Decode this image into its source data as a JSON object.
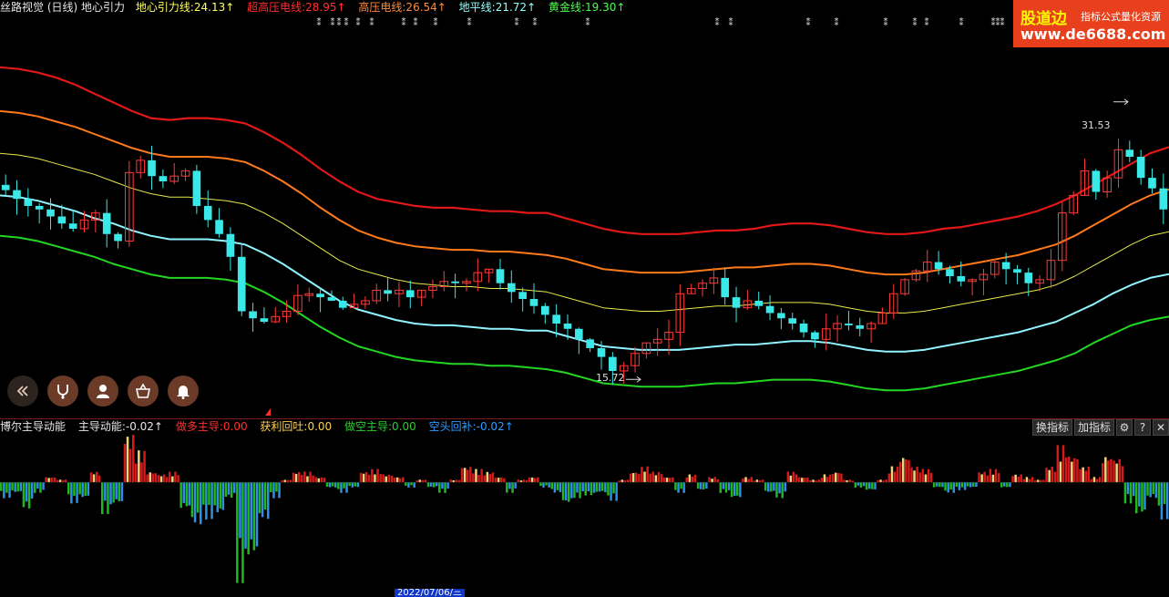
{
  "header": {
    "title": "丝路视觉 (日线) 地心引力",
    "indicators": [
      {
        "label": "地心引力线:24.13↑",
        "color": "#ffff66"
      },
      {
        "label": "超高压电线:28.95↑",
        "color": "#ff3030"
      },
      {
        "label": "高压电线:26.54↑",
        "color": "#ff8a3c"
      },
      {
        "label": "地平线:21.72↑",
        "color": "#8fffff"
      },
      {
        "label": "黄金线:19.30↑",
        "color": "#4dff4d"
      }
    ]
  },
  "logo": {
    "name": "股道边",
    "slogan": "指标公式量化资源",
    "url": "www.de6688.com"
  },
  "annotations": {
    "high": "31.53",
    "low": "15.72"
  },
  "sub_header": {
    "title": "博尔主导动能",
    "indicators": [
      {
        "label": "主导动能:-0.02↑",
        "color": "#e6e6e6"
      },
      {
        "label": "做多主导:0.00",
        "color": "#ff3030"
      },
      {
        "label": "获利回吐:0.00",
        "color": "#ffd24d"
      },
      {
        "label": "做空主导:0.00",
        "color": "#2ecc2e"
      },
      {
        "label": "空头回补:-0.02↑",
        "color": "#2d9bff"
      }
    ],
    "buttons": [
      "换指标",
      "加指标"
    ]
  },
  "date_tag": "2022/07/06/三",
  "toolbar_icons": [
    "collapse-icon",
    "stethoscope-icon",
    "advisor-icon",
    "basket-icon",
    "bell-icon"
  ],
  "colors": {
    "red_band": "#e01818",
    "orange_band": "#ff7a1a",
    "yellow_line": "#e8e84a",
    "cyan_band": "#8ff4ff",
    "green_band": "#22d622",
    "candle_up": "#ff3a3a",
    "candle_down": "#3ae8e8",
    "bar_red": "#d61a1a",
    "bar_yellow": "#f2d27a",
    "bar_green": "#1fb81f",
    "bar_blue": "#2e8fe6"
  },
  "chart_data": {
    "type": "line",
    "price_range": [
      13.5,
      36.5
    ],
    "series": [
      {
        "name": "超高压电线",
        "values": [
          33.5,
          33.4,
          33.2,
          32.9,
          32.5,
          32.0,
          31.5,
          31.0,
          30.6,
          30.5,
          30.6,
          30.6,
          30.5,
          30.3,
          29.8,
          29.2,
          28.5,
          27.7,
          27.0,
          26.4,
          26.0,
          25.8,
          25.6,
          25.5,
          25.5,
          25.4,
          25.3,
          25.3,
          25.2,
          25.2,
          24.9,
          24.6,
          24.3,
          24.1,
          24.0,
          24.0,
          24.0,
          24.1,
          24.2,
          24.2,
          24.3,
          24.5,
          24.6,
          24.6,
          24.5,
          24.3,
          24.1,
          24.0,
          24.0,
          24.1,
          24.3,
          24.4,
          24.6,
          24.8,
          25.0,
          25.3,
          25.7,
          26.2,
          26.8,
          27.4,
          28.0,
          28.6,
          28.95
        ]
      },
      {
        "name": "高压电线",
        "values": [
          31.0,
          30.9,
          30.7,
          30.4,
          30.1,
          29.7,
          29.3,
          28.9,
          28.6,
          28.4,
          28.4,
          28.4,
          28.3,
          28.1,
          27.6,
          27.0,
          26.3,
          25.5,
          24.8,
          24.2,
          23.8,
          23.5,
          23.3,
          23.2,
          23.1,
          23.1,
          23.0,
          23.0,
          22.9,
          22.8,
          22.6,
          22.3,
          22.0,
          21.9,
          21.8,
          21.8,
          21.8,
          21.9,
          22.0,
          22.1,
          22.1,
          22.2,
          22.3,
          22.3,
          22.2,
          22.0,
          21.8,
          21.7,
          21.7,
          21.8,
          22.0,
          22.2,
          22.4,
          22.6,
          22.8,
          23.1,
          23.4,
          23.9,
          24.5,
          25.1,
          25.7,
          26.2,
          26.54
        ]
      },
      {
        "name": "地心引力线",
        "values": [
          28.6,
          28.5,
          28.3,
          28.0,
          27.7,
          27.4,
          27.0,
          26.6,
          26.3,
          26.1,
          26.1,
          26.0,
          25.9,
          25.7,
          25.2,
          24.6,
          23.9,
          23.2,
          22.5,
          22.0,
          21.7,
          21.4,
          21.2,
          21.1,
          21.0,
          21.0,
          20.9,
          20.9,
          20.8,
          20.7,
          20.4,
          20.1,
          19.8,
          19.7,
          19.6,
          19.6,
          19.7,
          19.8,
          19.9,
          19.9,
          20.0,
          20.1,
          20.1,
          20.1,
          20.0,
          19.8,
          19.6,
          19.5,
          19.5,
          19.6,
          19.8,
          20.0,
          20.2,
          20.4,
          20.6,
          20.8,
          21.1,
          21.6,
          22.2,
          22.8,
          23.4,
          23.9,
          24.13
        ]
      },
      {
        "name": "地平线",
        "values": [
          26.2,
          26.1,
          25.9,
          25.6,
          25.3,
          24.9,
          24.6,
          24.2,
          23.9,
          23.7,
          23.7,
          23.7,
          23.6,
          23.4,
          22.9,
          22.3,
          21.6,
          20.9,
          20.2,
          19.7,
          19.4,
          19.1,
          18.9,
          18.8,
          18.8,
          18.7,
          18.6,
          18.6,
          18.5,
          18.5,
          18.2,
          17.9,
          17.6,
          17.5,
          17.4,
          17.4,
          17.4,
          17.5,
          17.6,
          17.7,
          17.7,
          17.8,
          17.9,
          17.9,
          17.8,
          17.6,
          17.4,
          17.3,
          17.3,
          17.4,
          17.6,
          17.8,
          18.0,
          18.2,
          18.4,
          18.7,
          19.0,
          19.5,
          20.0,
          20.6,
          21.1,
          21.5,
          21.72
        ]
      },
      {
        "name": "黄金线",
        "values": [
          23.9,
          23.8,
          23.6,
          23.3,
          23.0,
          22.7,
          22.3,
          22.0,
          21.7,
          21.5,
          21.5,
          21.5,
          21.4,
          21.2,
          20.7,
          20.1,
          19.4,
          18.7,
          18.1,
          17.6,
          17.3,
          17.0,
          16.8,
          16.7,
          16.6,
          16.6,
          16.5,
          16.5,
          16.4,
          16.3,
          16.1,
          15.8,
          15.5,
          15.4,
          15.3,
          15.3,
          15.3,
          15.4,
          15.5,
          15.5,
          15.6,
          15.7,
          15.7,
          15.7,
          15.6,
          15.4,
          15.2,
          15.1,
          15.1,
          15.2,
          15.4,
          15.6,
          15.8,
          16.0,
          16.2,
          16.5,
          16.8,
          17.2,
          17.8,
          18.3,
          18.8,
          19.1,
          19.3
        ]
      }
    ],
    "closes": [
      26.5,
      26.0,
      25.6,
      25.4,
      25.0,
      24.6,
      24.3,
      24.8,
      25.2,
      24.0,
      23.6,
      27.5,
      28.2,
      27.3,
      27.0,
      27.3,
      27.6,
      25.6,
      24.8,
      24.0,
      22.7,
      19.6,
      19.2,
      19.0,
      19.3,
      19.6,
      20.5,
      20.6,
      20.4,
      20.2,
      19.8,
      20.0,
      20.2,
      20.8,
      20.6,
      20.8,
      20.4,
      20.8,
      21.0,
      21.3,
      21.2,
      21.3,
      21.8,
      22.0,
      21.2,
      20.7,
      20.3,
      19.9,
      19.4,
      18.9,
      18.6,
      18.0,
      17.5,
      17.0,
      16.2,
      16.5,
      17.2,
      17.8,
      18.0,
      18.4,
      20.6,
      20.9,
      21.2,
      21.5,
      20.4,
      19.8,
      20.2,
      19.9,
      19.5,
      19.2,
      18.9,
      18.4,
      18.0,
      18.6,
      18.9,
      18.8,
      18.6,
      18.9,
      19.5,
      20.6,
      21.4,
      21.9,
      22.4,
      22.0,
      21.6,
      21.3,
      21.4,
      21.7,
      22.4,
      22.0,
      21.8,
      21.2,
      21.4,
      22.5,
      25.2,
      26.2,
      27.6,
      26.4,
      27.2,
      28.8,
      28.4,
      27.2,
      26.6,
      25.4
    ],
    "high": 31.53,
    "low": 15.72,
    "sub_range": [
      -0.22,
      0.1
    ],
    "momentum": [
      [
        0,
        -0.03
      ],
      [
        1,
        -0.02
      ],
      [
        2,
        -0.05
      ],
      [
        3,
        -0.02
      ],
      [
        4,
        0.01
      ],
      [
        5,
        0.005
      ],
      [
        6,
        -0.04
      ],
      [
        7,
        -0.03
      ],
      [
        8,
        0.02
      ],
      [
        9,
        -0.06
      ],
      [
        10,
        -0.04
      ],
      [
        11,
        0.09
      ],
      [
        12,
        0.06
      ],
      [
        13,
        0.02
      ],
      [
        14,
        0.015
      ],
      [
        15,
        0.02
      ],
      [
        16,
        -0.05
      ],
      [
        17,
        -0.08
      ],
      [
        18,
        -0.07
      ],
      [
        19,
        -0.06
      ],
      [
        20,
        -0.03
      ],
      [
        21,
        -0.19
      ],
      [
        22,
        -0.14
      ],
      [
        23,
        -0.07
      ],
      [
        24,
        -0.03
      ],
      [
        25,
        0.005
      ],
      [
        26,
        0.02
      ],
      [
        27,
        0.02
      ],
      [
        28,
        0.01
      ],
      [
        29,
        -0.01
      ],
      [
        30,
        -0.02
      ],
      [
        31,
        -0.01
      ],
      [
        32,
        0.02
      ],
      [
        33,
        0.025
      ],
      [
        34,
        0.015
      ],
      [
        35,
        0.01
      ],
      [
        36,
        -0.01
      ],
      [
        37,
        0.005
      ],
      [
        38,
        -0.01
      ],
      [
        39,
        -0.02
      ],
      [
        40,
        0.005
      ],
      [
        41,
        0.03
      ],
      [
        42,
        0.025
      ],
      [
        43,
        0.02
      ],
      [
        44,
        0.01
      ],
      [
        45,
        -0.02
      ],
      [
        46,
        0.005
      ],
      [
        47,
        0.01
      ],
      [
        48,
        -0.01
      ],
      [
        49,
        -0.02
      ],
      [
        50,
        -0.04
      ],
      [
        51,
        -0.03
      ],
      [
        52,
        -0.025
      ],
      [
        53,
        -0.02
      ],
      [
        54,
        -0.035
      ],
      [
        55,
        0.005
      ],
      [
        56,
        0.02
      ],
      [
        57,
        0.03
      ],
      [
        58,
        0.02
      ],
      [
        59,
        0.01
      ],
      [
        60,
        -0.02
      ],
      [
        61,
        0.015
      ],
      [
        62,
        -0.015
      ],
      [
        63,
        0.01
      ],
      [
        64,
        -0.02
      ],
      [
        65,
        -0.03
      ],
      [
        66,
        0.01
      ],
      [
        67,
        0.005
      ],
      [
        68,
        -0.02
      ],
      [
        69,
        -0.03
      ],
      [
        70,
        0.02
      ],
      [
        71,
        0.01
      ],
      [
        72,
        0.005
      ],
      [
        73,
        0.015
      ],
      [
        74,
        0.02
      ],
      [
        75,
        0.005
      ],
      [
        76,
        -0.01
      ],
      [
        77,
        -0.015
      ],
      [
        78,
        0.005
      ],
      [
        79,
        0.03
      ],
      [
        80,
        0.05
      ],
      [
        81,
        0.03
      ],
      [
        82,
        0.025
      ],
      [
        83,
        -0.01
      ],
      [
        84,
        -0.02
      ],
      [
        85,
        -0.015
      ],
      [
        86,
        -0.01
      ],
      [
        87,
        0.02
      ],
      [
        88,
        0.025
      ],
      [
        89,
        -0.01
      ],
      [
        90,
        0.015
      ],
      [
        91,
        0.01
      ],
      [
        92,
        0.005
      ],
      [
        93,
        0.03
      ],
      [
        94,
        0.07
      ],
      [
        95,
        0.05
      ],
      [
        96,
        0.03
      ],
      [
        97,
        0.01
      ],
      [
        98,
        0.05
      ],
      [
        99,
        0.045
      ],
      [
        100,
        -0.04
      ],
      [
        101,
        -0.06
      ],
      [
        102,
        -0.03
      ],
      [
        103,
        -0.07
      ]
    ]
  }
}
